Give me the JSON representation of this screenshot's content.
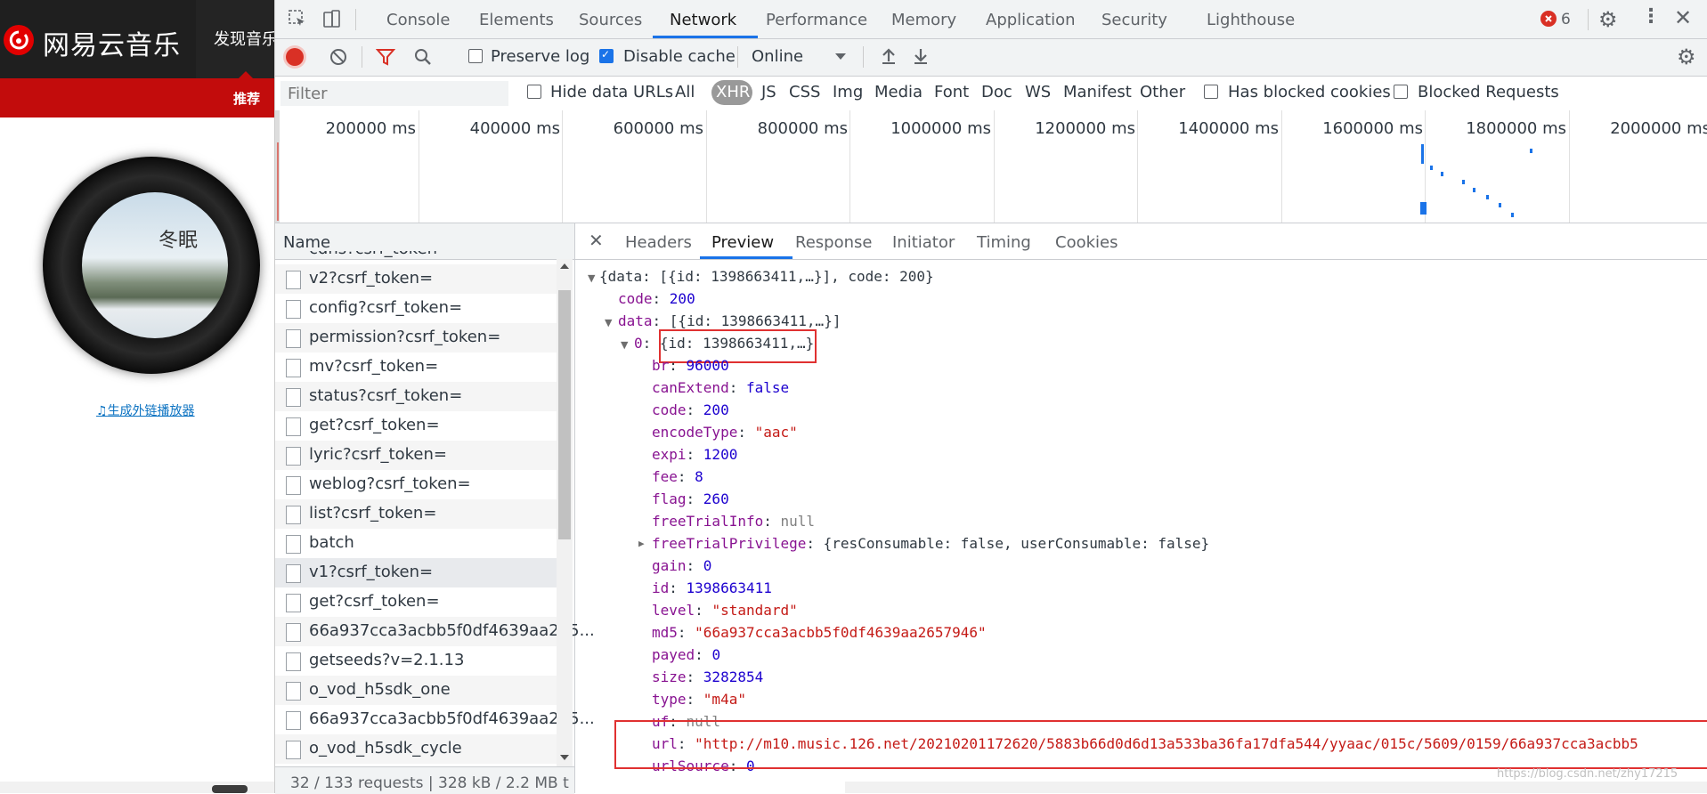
{
  "site": {
    "logo_text": "网易云音乐",
    "nav_tab": "发现音乐",
    "subnav_item": "推荐",
    "cover_title": "冬眠",
    "player_link": "生成外链播放器"
  },
  "devtools": {
    "tabs": [
      "Console",
      "Elements",
      "Sources",
      "Network",
      "Performance",
      "Memory",
      "Application",
      "Security",
      "Lighthouse"
    ],
    "active_tab": "Network",
    "error_count": "6",
    "preserve_log": "Preserve log",
    "disable_cache": "Disable cache",
    "throttle": "Online",
    "filter_placeholder": "Filter",
    "hide_data_urls": "Hide data URLs",
    "type_filters": [
      "All",
      "XHR",
      "JS",
      "CSS",
      "Img",
      "Media",
      "Font",
      "Doc",
      "WS",
      "Manifest",
      "Other"
    ],
    "has_blocked_cookies": "Has blocked cookies",
    "blocked_requests": "Blocked Requests",
    "timeline_labels": [
      "200000 ms",
      "400000 ms",
      "600000 ms",
      "800000 ms",
      "1000000 ms",
      "1200000 ms",
      "1400000 ms",
      "1600000 ms",
      "1800000 ms",
      "2000000 ms"
    ],
    "name_header": "Name",
    "requests": [
      "v2?csrf_token=",
      "config?csrf_token=",
      "permission?csrf_token=",
      "mv?csrf_token=",
      "status?csrf_token=",
      "get?csrf_token=",
      "lyric?csrf_token=",
      "weblog?csrf_token=",
      "list?csrf_token=",
      "batch",
      "v1?csrf_token=",
      "get?csrf_token=",
      "66a937cca3acbb5f0df4639aa265...",
      "getseeds?v=2.1.13",
      "o_vod_h5sdk_one",
      "66a937cca3acbb5f0df4639aa265...",
      "o_vod_h5sdk_cycle"
    ],
    "partial_top_request": "cdns?csrf_token=",
    "status": "32 / 133 requests  |  328 kB / 2.2 MB t",
    "detail_tabs": [
      "Headers",
      "Preview",
      "Response",
      "Initiator",
      "Timing",
      "Cookies"
    ],
    "active_detail_tab": "Preview"
  },
  "preview": {
    "root": "{data: [{id: 1398663411,…}], code: 200}",
    "code_key": "code",
    "code_val": "200",
    "data_key": "data",
    "data_val": "[{id: 1398663411,…}]",
    "item_key": "0",
    "item_val": "{id: 1398663411,…}",
    "fields": [
      {
        "k": "br",
        "v": "96000",
        "t": "num"
      },
      {
        "k": "canExtend",
        "v": "false",
        "t": "num"
      },
      {
        "k": "code",
        "v": "200",
        "t": "num"
      },
      {
        "k": "encodeType",
        "v": "\"aac\"",
        "t": "str"
      },
      {
        "k": "expi",
        "v": "1200",
        "t": "num"
      },
      {
        "k": "fee",
        "v": "8",
        "t": "num"
      },
      {
        "k": "flag",
        "v": "260",
        "t": "num"
      },
      {
        "k": "freeTrialInfo",
        "v": "null",
        "t": "nul"
      },
      {
        "k": "freeTrialPrivilege",
        "v": "{resConsumable: false, userConsumable: false}",
        "t": "pl"
      },
      {
        "k": "gain",
        "v": "0",
        "t": "num"
      },
      {
        "k": "id",
        "v": "1398663411",
        "t": "num"
      },
      {
        "k": "level",
        "v": "\"standard\"",
        "t": "str"
      },
      {
        "k": "md5",
        "v": "\"66a937cca3acbb5f0df4639aa2657946\"",
        "t": "str"
      },
      {
        "k": "payed",
        "v": "0",
        "t": "num"
      },
      {
        "k": "size",
        "v": "3282854",
        "t": "num"
      },
      {
        "k": "type",
        "v": "\"m4a\"",
        "t": "str"
      },
      {
        "k": "uf",
        "v": "null",
        "t": "nul"
      },
      {
        "k": "url",
        "v": "\"http://m10.music.126.net/20210201172620/5883b66d0d6d13a533ba36fa17dfa544/yyaac/015c/5609/0159/66a937cca3acbb5",
        "t": "str"
      },
      {
        "k": "urlSource",
        "v": "0",
        "t": "num"
      }
    ]
  },
  "watermark": "https://blog.csdn.net/zhy17215"
}
